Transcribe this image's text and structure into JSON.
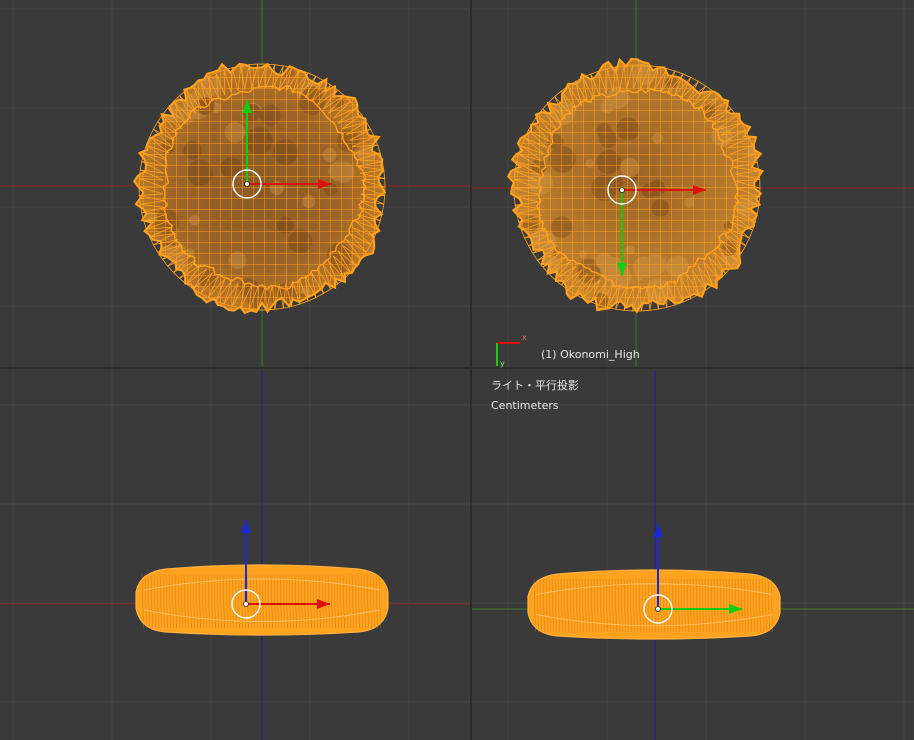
{
  "viewports": {
    "top_right": {
      "object_name": "(1) Okonomi_High",
      "view_name": "ライト・平行投影",
      "units": "Centimeters",
      "mini_axis": {
        "x_label": "x",
        "y_label": "y"
      }
    }
  },
  "colors": {
    "background": "#3a3a3a",
    "grid": "#444444",
    "viewport_divider": "#2b2b2b",
    "axis_x": "#8a2323",
    "axis_y": "#3f7a2a",
    "axis_z": "#23238a",
    "wire": "#ffa21e",
    "fill_light": "#c98028",
    "fill_dark": "#7a4c1c",
    "gizmo_red": "#dd1010",
    "gizmo_green": "#11cc11",
    "gizmo_blue": "#1a2ad6",
    "pivot_ring": "#ffffff"
  },
  "icons": {
    "translate_gizmo": "transform-arrows-icon",
    "pivot": "pivot-circle-icon"
  }
}
